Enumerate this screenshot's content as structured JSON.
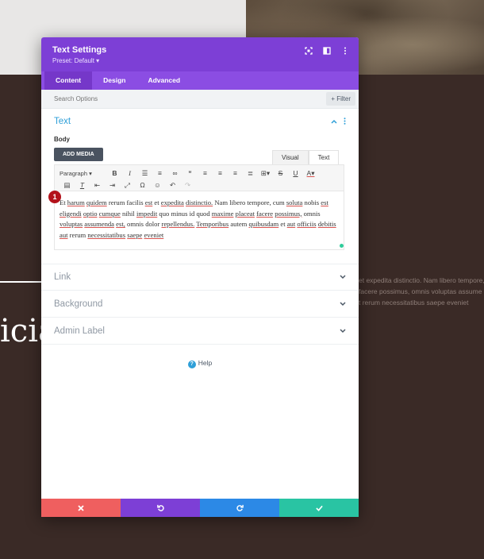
{
  "background": {
    "heading_fragment": "icia",
    "paragraph_lines": [
      "et expedita distinctio. Nam libero tempore,",
      "facere possimus, omnis voluptas assume",
      "t rerum necessitatibus saepe eveniet"
    ]
  },
  "modal": {
    "title": "Text Settings",
    "preset": "Preset: Default ▾",
    "tabs": [
      "Content",
      "Design",
      "Advanced"
    ],
    "search_placeholder": "Search Options",
    "filter_label": "+ Filter",
    "text_section": {
      "title": "Text",
      "body_label": "Body",
      "add_media": "ADD MEDIA",
      "editor_tabs": [
        "Visual",
        "Text"
      ],
      "paragraph_select": "Paragraph",
      "marker": "1",
      "content": "Et harum quidem rerum facilis est et expedita distinctio. Nam libero tempore, cum soluta nobis est eligendi optio cumque nihil impedit quo minus id quod maxime placeat facere possimus, omnis voluptas assumenda est, omnis dolor repellendus. Temporibus autem quibusdam et aut officiis debitis aut rerum necessitatibus saepe eveniet"
    },
    "sections": [
      {
        "title": "Link"
      },
      {
        "title": "Background"
      },
      {
        "title": "Admin Label"
      }
    ],
    "help_label": "Help"
  },
  "footer_icons": [
    "close-icon",
    "undo-icon",
    "redo-icon",
    "check-icon"
  ],
  "colors": {
    "header": "#7d3fd6",
    "tabs": "#8b4de3",
    "accent_blue": "#2e9fd8",
    "cancel": "#ef5f5f",
    "redo": "#2c89e6",
    "save": "#29c4a3",
    "marker": "#b3121b"
  }
}
